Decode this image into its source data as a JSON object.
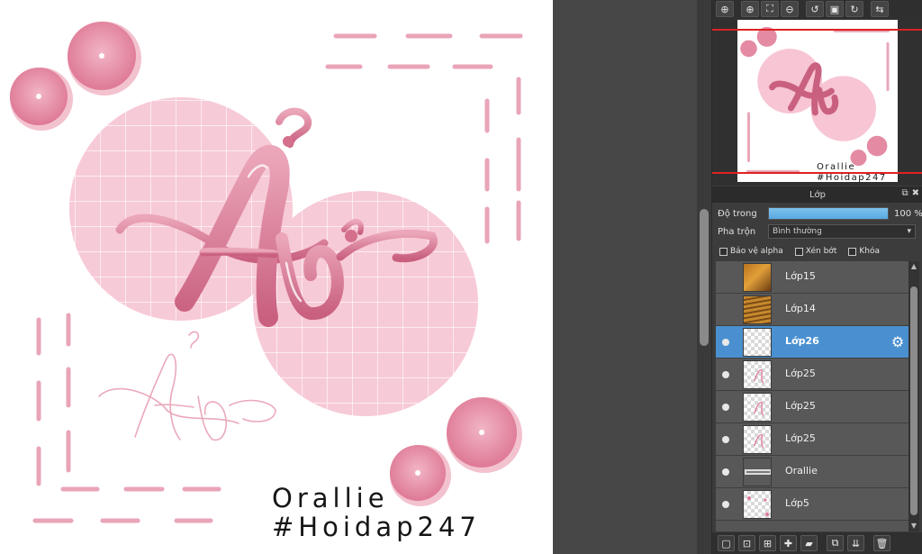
{
  "canvas": {
    "signature_line1": "Orallie",
    "signature_line2": "#Hoidap247",
    "colors": {
      "pink_light": "#f7c5d3",
      "pink_dark": "#e07a97",
      "dash": "#e9a4b7"
    }
  },
  "nav_toolbar": {
    "buttons": [
      "zoom-fit-icon",
      "zoom-in-icon",
      "fit-window-icon",
      "zoom-out-icon",
      "rotate-left-icon",
      "fullscreen-icon",
      "rotate-right-icon",
      "flip-icon"
    ]
  },
  "layer_panel": {
    "title": "Lớp",
    "opacity_label": "Độ trong",
    "opacity_value": "100 %",
    "opacity_percent": 100,
    "blend_label": "Pha trộn",
    "blend_mode": "Bình thường",
    "checkbox_alpha": "Bảo vệ alpha",
    "checkbox_clip": "Xén bớt",
    "checkbox_lock": "Khóa",
    "layers": [
      {
        "name": "Lớp15",
        "visible": false,
        "selected": false,
        "thumb": "photo-orange"
      },
      {
        "name": "Lớp14",
        "visible": false,
        "selected": false,
        "thumb": "photo-stripes"
      },
      {
        "name": "Lớp26",
        "visible": true,
        "selected": true,
        "thumb": "transparent"
      },
      {
        "name": "Lớp25",
        "visible": true,
        "selected": false,
        "thumb": "sketch"
      },
      {
        "name": "Lớp25",
        "visible": true,
        "selected": false,
        "thumb": "sketch"
      },
      {
        "name": "Lớp25",
        "visible": true,
        "selected": false,
        "thumb": "sketch"
      },
      {
        "name": "Orallie",
        "visible": true,
        "selected": false,
        "thumb": "text"
      },
      {
        "name": "Lớp5",
        "visible": true,
        "selected": false,
        "thumb": "pink"
      }
    ]
  },
  "layer_toolbar": {
    "buttons": [
      "new-layer-icon",
      "new-raster-icon",
      "new-layer-set-icon",
      "add-effect-icon",
      "folder-icon",
      "duplicate-icon",
      "merge-icon",
      "trash-icon"
    ]
  }
}
